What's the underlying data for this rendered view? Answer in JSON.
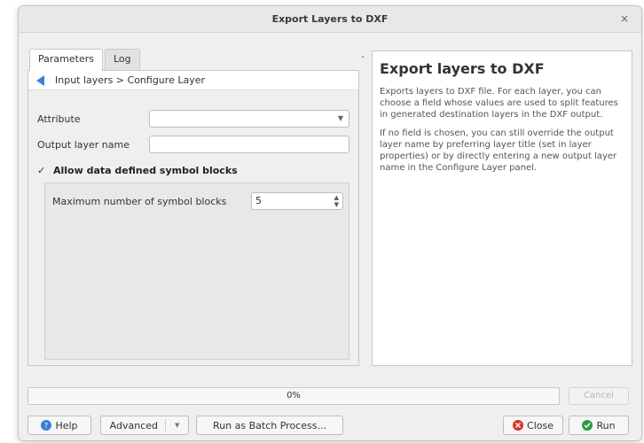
{
  "window": {
    "title": "Export Layers to DXF",
    "close_label": "×"
  },
  "tabs": [
    {
      "label": "Parameters",
      "active": true
    },
    {
      "label": "Log",
      "active": false
    }
  ],
  "breadcrumb": {
    "text": "Input layers > Configure Layer"
  },
  "form": {
    "attribute_label": "Attribute",
    "attribute_value": "",
    "output_layer_name_label": "Output layer name",
    "output_layer_name_value": "",
    "allow_symbol_blocks_label": "Allow data defined symbol blocks",
    "allow_symbol_blocks_checked": true,
    "checkmark": "✓",
    "max_symbol_blocks_label": "Maximum number of symbol blocks",
    "max_symbol_blocks_value": "5"
  },
  "help": {
    "title": "Export layers to DXF",
    "paragraph1": "Exports layers to DXF file. For each layer, you can choose a field whose values are used to split features in generated destination layers in the DXF output.",
    "paragraph2": "If no field is chosen, you can still override the output layer name by preferring layer title (set in layer properties) or by directly entering a new output layer name in the Configure Layer panel."
  },
  "progress": {
    "text": "0%",
    "value": 0
  },
  "buttons": {
    "cancel": "Cancel",
    "help": "Help",
    "advanced": "Advanced",
    "batch": "Run as Batch Process...",
    "close": "Close",
    "run": "Run"
  },
  "colors": {
    "help_icon": "#3d7fd6",
    "close_icon": "#d9342b",
    "run_icon": "#2e9a3c",
    "back_arrow": "#3d7fd6"
  }
}
